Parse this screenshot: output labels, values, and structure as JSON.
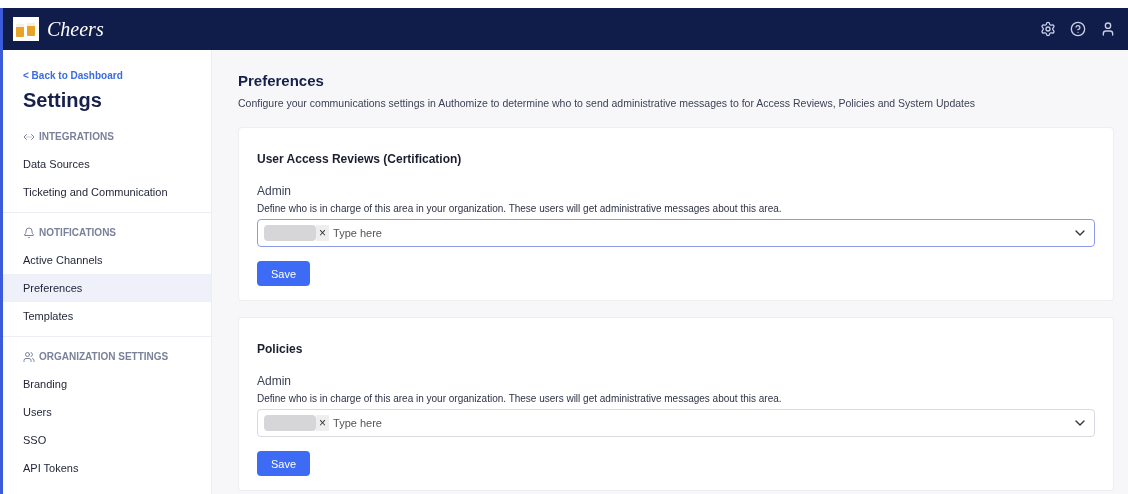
{
  "header": {
    "brand": "Cheers"
  },
  "sidebar": {
    "back_link": "< Back to Dashboard",
    "title": "Settings",
    "sections": [
      {
        "kind": "integrations",
        "heading": "INTEGRATIONS",
        "items": [
          {
            "label": "Data Sources",
            "selected": false
          },
          {
            "label": "Ticketing and Communication",
            "selected": false
          }
        ]
      },
      {
        "kind": "notifications",
        "heading": "NOTIFICATIONS",
        "items": [
          {
            "label": "Active Channels",
            "selected": false
          },
          {
            "label": "Preferences",
            "selected": true
          },
          {
            "label": "Templates",
            "selected": false
          }
        ]
      },
      {
        "kind": "organization",
        "heading": "ORGANIZATION SETTINGS",
        "items": [
          {
            "label": "Branding",
            "selected": false
          },
          {
            "label": "Users",
            "selected": false
          },
          {
            "label": "SSO",
            "selected": false
          },
          {
            "label": "API Tokens",
            "selected": false
          }
        ]
      }
    ]
  },
  "page": {
    "title": "Preferences",
    "description": "Configure your communications settings in Authomize to determine who to send administrative messages to for Access Reviews, Policies and System Updates"
  },
  "cards": [
    {
      "title": "User Access Reviews (Certification)",
      "field_label": "Admin",
      "help": "Define who is in charge of this area in your organization. These users will get administrative messages about this area.",
      "remove": "×",
      "placeholder": "Type here",
      "focused": true,
      "button": "Save"
    },
    {
      "title": "Policies",
      "field_label": "Admin",
      "help": "Define who is in charge of this area in your organization. These users will get administrative messages about this area.",
      "remove": "×",
      "placeholder": "Type here",
      "focused": false,
      "button": "Save"
    }
  ]
}
